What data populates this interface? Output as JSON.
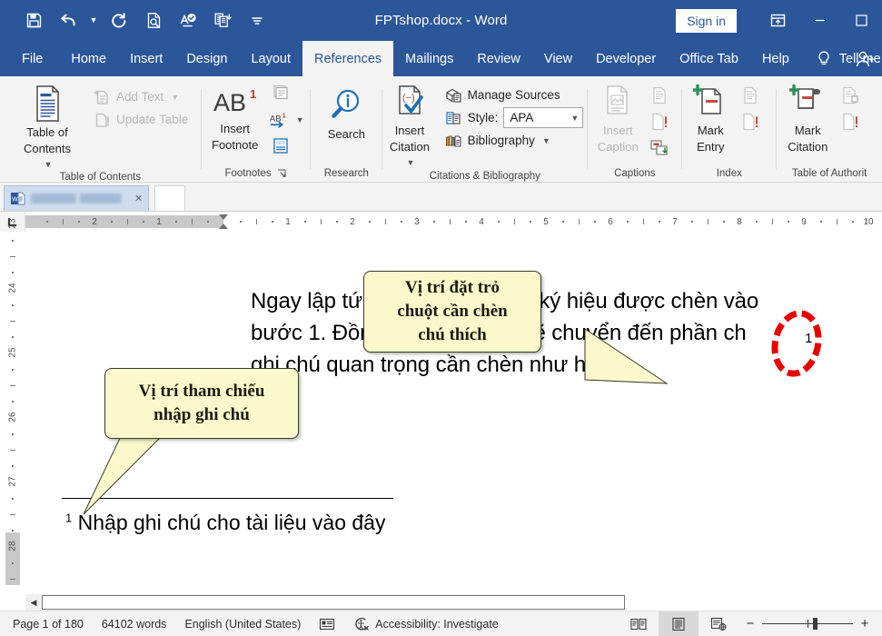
{
  "titlebar": {
    "document_title": "FPTshop.docx  -  Word",
    "signin_label": "Sign in",
    "qat": [
      {
        "name": "save-icon",
        "tooltip": "Save"
      },
      {
        "name": "undo-icon",
        "tooltip": "Undo"
      },
      {
        "name": "redo-icon",
        "tooltip": "Redo"
      },
      {
        "name": "print-preview-icon",
        "tooltip": "Print Preview and Print"
      },
      {
        "name": "spelling-grammar-icon",
        "tooltip": "Spelling & Grammar"
      },
      {
        "name": "copy-format-icon",
        "tooltip": "Copy"
      },
      {
        "name": "customize-qat-icon",
        "tooltip": "Customize Quick Access Toolbar"
      }
    ],
    "window_controls": [
      {
        "name": "ribbon-display-options-icon"
      },
      {
        "name": "minimize-icon"
      },
      {
        "name": "maximize-icon"
      }
    ]
  },
  "tabs": {
    "items": [
      {
        "label": "File",
        "active": false
      },
      {
        "label": "Home",
        "active": false
      },
      {
        "label": "Insert",
        "active": false
      },
      {
        "label": "Design",
        "active": false
      },
      {
        "label": "Layout",
        "active": false
      },
      {
        "label": "References",
        "active": true
      },
      {
        "label": "Mailings",
        "active": false
      },
      {
        "label": "Review",
        "active": false
      },
      {
        "label": "View",
        "active": false
      },
      {
        "label": "Developer",
        "active": false
      },
      {
        "label": "Office Tab",
        "active": false
      },
      {
        "label": "Help",
        "active": false
      }
    ],
    "tell_me_label": "Tell me"
  },
  "ribbon": {
    "groups": [
      {
        "label": "Table of Contents",
        "big_button": {
          "label_line1": "Table of",
          "label_line2": "Contents",
          "icon": "table-of-contents-icon",
          "has_caret": true
        },
        "small_items": [
          {
            "label": "Add Text",
            "icon": "add-text-icon",
            "disabled": true,
            "has_caret": true
          },
          {
            "label": "Update Table",
            "icon": "update-table-icon",
            "disabled": true,
            "has_caret": false
          }
        ]
      },
      {
        "label": "Footnotes",
        "has_dialog_launcher": true,
        "big_button": {
          "label_line1": "Insert",
          "label_line2": "Footnote",
          "icon": "insert-footnote-icon",
          "has_caret": false
        },
        "mini_icons": [
          "insert-endnote-icon",
          "next-footnote-icon",
          "show-notes-icon"
        ],
        "next_footnote_caret": true
      },
      {
        "label": "Research",
        "big_button": {
          "label_line1": "Search",
          "label_line2": "",
          "icon": "smart-lookup-search-icon",
          "has_caret": false
        }
      },
      {
        "label": "Citations & Bibliography",
        "big_button": {
          "label_line1": "Insert",
          "label_line2": "Citation",
          "icon": "insert-citation-icon",
          "has_caret": true
        },
        "small_items": [
          {
            "label": "Manage Sources",
            "icon": "manage-sources-icon",
            "disabled": false,
            "has_caret": false
          },
          {
            "label": "Style:",
            "icon": "style-icon",
            "disabled": false,
            "has_caret": false,
            "combo_value": "APA"
          },
          {
            "label": "Bibliography",
            "icon": "bibliography-icon",
            "disabled": false,
            "has_caret": true
          }
        ]
      },
      {
        "label": "Captions",
        "big_button": {
          "label_line1": "Insert",
          "label_line2": "Caption",
          "icon": "insert-caption-icon",
          "has_caret": false,
          "disabled": true
        },
        "mini_icons": [
          "insert-table-of-figures-icon",
          "update-table-figures-icon",
          "cross-reference-icon"
        ]
      },
      {
        "label": "Index",
        "big_button": {
          "label_line1": "Mark",
          "label_line2": "Entry",
          "icon": "mark-entry-icon",
          "has_caret": false
        },
        "mini_icons": [
          "insert-index-icon",
          "update-index-icon"
        ]
      },
      {
        "label": "Table of Authorit",
        "big_button": {
          "label_line1": "Mark",
          "label_line2": "Citation",
          "icon": "mark-citation-icon",
          "has_caret": false
        },
        "mini_icons": [
          "insert-table-of-authorities-icon",
          "update-table-authorities-icon"
        ]
      }
    ]
  },
  "doctabs": {
    "active_tab_name": "",
    "close_label": "×"
  },
  "rulers": {
    "horizontal_ticks": [
      "2",
      "1",
      "1",
      "2",
      "3",
      "4",
      "5",
      "6",
      "7",
      "8",
      "9",
      "10"
    ],
    "vertical_ticks": [
      "23",
      "24",
      "25",
      "26",
      "27",
      "28"
    ]
  },
  "document": {
    "cut_top_line": "",
    "paragraph_lines": [
      "Ngay lập tức bạn sẽ thấy một ký hiệu được chèn vào",
      "bước 1. Đồng thời trỏ chuột sẽ chuyển đến phần ch",
      "ghi chú quan trọng cần chèn như hình."
    ],
    "footnote_marker": "1",
    "footnote_text": "Nhập ghi chú cho tài liệu vào đây",
    "inline_footnote_ref": "1"
  },
  "callouts": [
    {
      "name": "callout-cursor-position",
      "lines": [
        "Vị trí đặt trỏ",
        "chuột cần chèn",
        "chú thích"
      ]
    },
    {
      "name": "callout-reference-position",
      "lines": [
        "Vị trí tham chiếu",
        "nhập ghi chú"
      ]
    }
  ],
  "annotations": {
    "red_circle_name": "red-dashed-circle-highlight",
    "red_color": "#e60000"
  },
  "statusbar": {
    "page_label": "Page 1 of 180",
    "words_label": "64102 words",
    "language_label": "English (United States)",
    "proofing_icon": "proofing-errors-icon",
    "accessibility_label": "Accessibility: Investigate",
    "views": [
      {
        "name": "read-mode-view-icon",
        "selected": false
      },
      {
        "name": "print-layout-view-icon",
        "selected": true
      },
      {
        "name": "web-layout-view-icon",
        "selected": false
      }
    ],
    "zoom_out": "−",
    "zoom_in": "+"
  },
  "colors": {
    "word_blue": "#2b579a",
    "ribbon_bg": "#f3f3f3",
    "callout_fill": "#fbf8cc",
    "accent_red": "#e60000"
  }
}
